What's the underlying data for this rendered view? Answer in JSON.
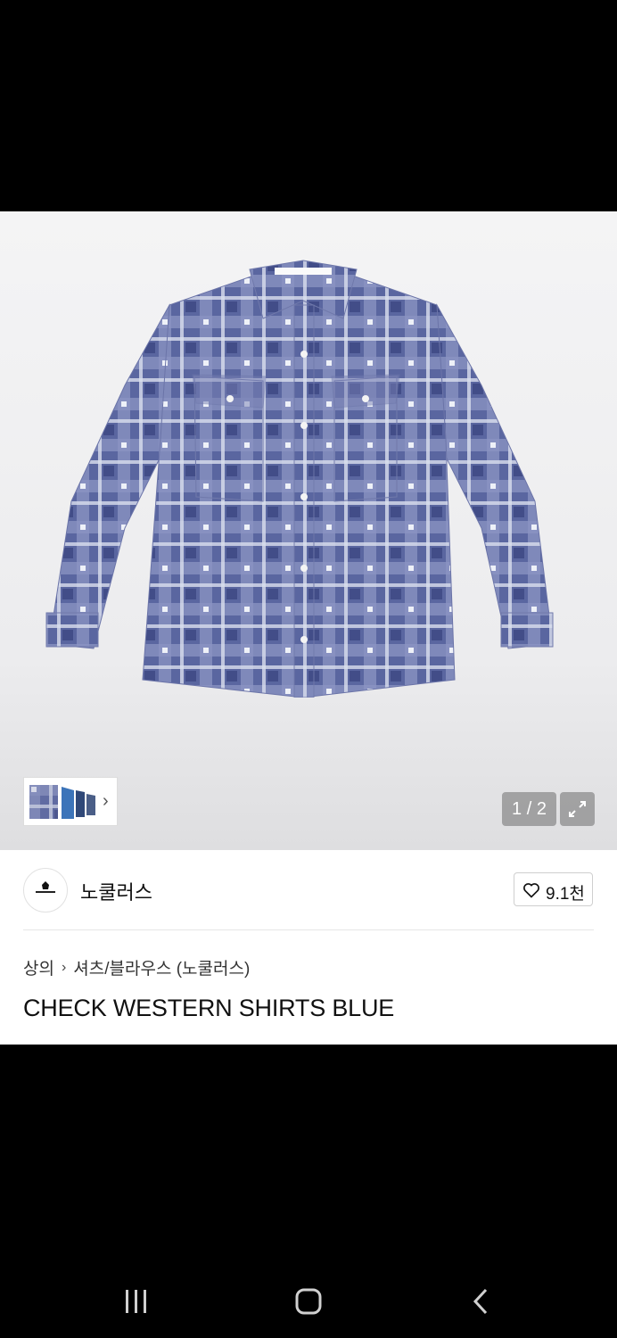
{
  "gallery": {
    "image_alt": "CHECK WESTERN SHIRTS BLUE",
    "counter": "1 / 2"
  },
  "brand": {
    "name": "노쿨러스",
    "likes": "9.1천"
  },
  "product": {
    "category": "상의",
    "subcategory": "셔츠/블라우스 (노쿨러스)",
    "title": "CHECK WESTERN SHIRTS BLUE"
  },
  "colors": {
    "plaid_dark": "#4e5a94",
    "plaid_light": "#e8ecf5",
    "hero_bg": "#efeff1"
  },
  "system_nav": {
    "icons": [
      "recent-apps-icon",
      "home-icon",
      "back-icon"
    ]
  }
}
